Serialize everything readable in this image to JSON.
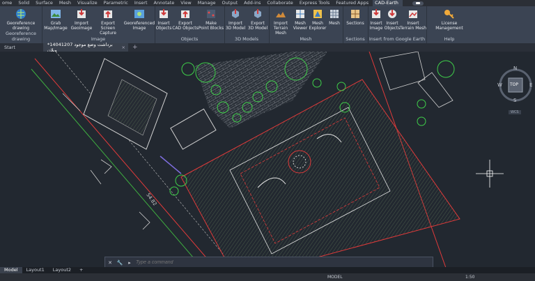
{
  "ribbon_tabs": [
    "ome",
    "Solid",
    "Surface",
    "Mesh",
    "Visualize",
    "Parametric",
    "Insert",
    "Annotate",
    "View",
    "Manage",
    "Output",
    "Add-ins",
    "Collaborate",
    "Express Tools",
    "Featured Apps",
    "CAD-Earth"
  ],
  "active_tab": "CAD-Earth",
  "panels": {
    "georef": {
      "btn": "Georeference drawing",
      "title": "Georeference drawing"
    },
    "image": {
      "title": "Image",
      "buttons": [
        {
          "l1": "Grab",
          "l2": "Map/Image"
        },
        {
          "l1": "Import",
          "l2": "Geoimage"
        },
        {
          "l1": "Export",
          "l2": "Screen Capture"
        },
        {
          "l1": "Georeferenced",
          "l2": "Image"
        }
      ]
    },
    "objects": {
      "title": "Objects",
      "buttons": [
        {
          "l1": "Insert",
          "l2": "Objects"
        },
        {
          "l1": "Export",
          "l2": "CAD Objects"
        },
        {
          "l1": "Make",
          "l2": "Point Blocks"
        }
      ]
    },
    "models3d": {
      "title": "3D Models",
      "buttons": [
        {
          "l1": "Import",
          "l2": "3D Model"
        },
        {
          "l1": "Export",
          "l2": "3D Model"
        }
      ]
    },
    "mesh": {
      "title": "Mesh",
      "buttons": [
        {
          "l1": "Import",
          "l2": "Terrain Mesh"
        },
        {
          "l1": "Mesh",
          "l2": "Viewer"
        },
        {
          "l1": "Mesh",
          "l2": "Explorer"
        },
        {
          "l1": "Mesh",
          "l2": ""
        }
      ]
    },
    "sections": {
      "title": "Sections",
      "buttons": [
        {
          "l1": "Sections",
          "l2": ""
        }
      ]
    },
    "google": {
      "title": "Insert from Google Earth",
      "buttons": [
        {
          "l1": "Insert",
          "l2": "Image"
        },
        {
          "l1": "Insert",
          "l2": "Objects"
        },
        {
          "l1": "Insert",
          "l2": "Terrain Mesh"
        }
      ]
    },
    "help": {
      "title": "Help",
      "buttons": [
        {
          "l1": "License",
          "l2": "Management"
        }
      ]
    }
  },
  "doc_tabs": {
    "start": "Start",
    "active": "*برداشت وضع موجود 14041207 ویلان",
    "close": "×",
    "plus": "+"
  },
  "drawing": {
    "dimension": "54.82",
    "viewcube": {
      "n": "N",
      "s": "S",
      "e": "E",
      "w": "W",
      "top": "TOP",
      "wcs": "WCS"
    }
  },
  "command": {
    "placeholder": "Type a command"
  },
  "layout_tabs": [
    "Model",
    "Layout1",
    "Layout2"
  ],
  "status": {
    "model": "MODEL",
    "scale": "1:50"
  },
  "colors": {
    "accent": "#3e4756",
    "ribbon": "#3b4453",
    "canvas": "#222830"
  },
  "icons": [
    "globe-icon",
    "map-grab-icon",
    "import-icon",
    "export-icon",
    "georef-image-icon",
    "insert-objects-icon",
    "export-cad-icon",
    "point-blocks-icon",
    "3d-import-icon",
    "3d-export-icon",
    "terrain-mesh-icon",
    "mesh-viewer-icon",
    "mesh-explorer-icon",
    "mesh-icon",
    "sections-icon",
    "license-key-icon"
  ]
}
